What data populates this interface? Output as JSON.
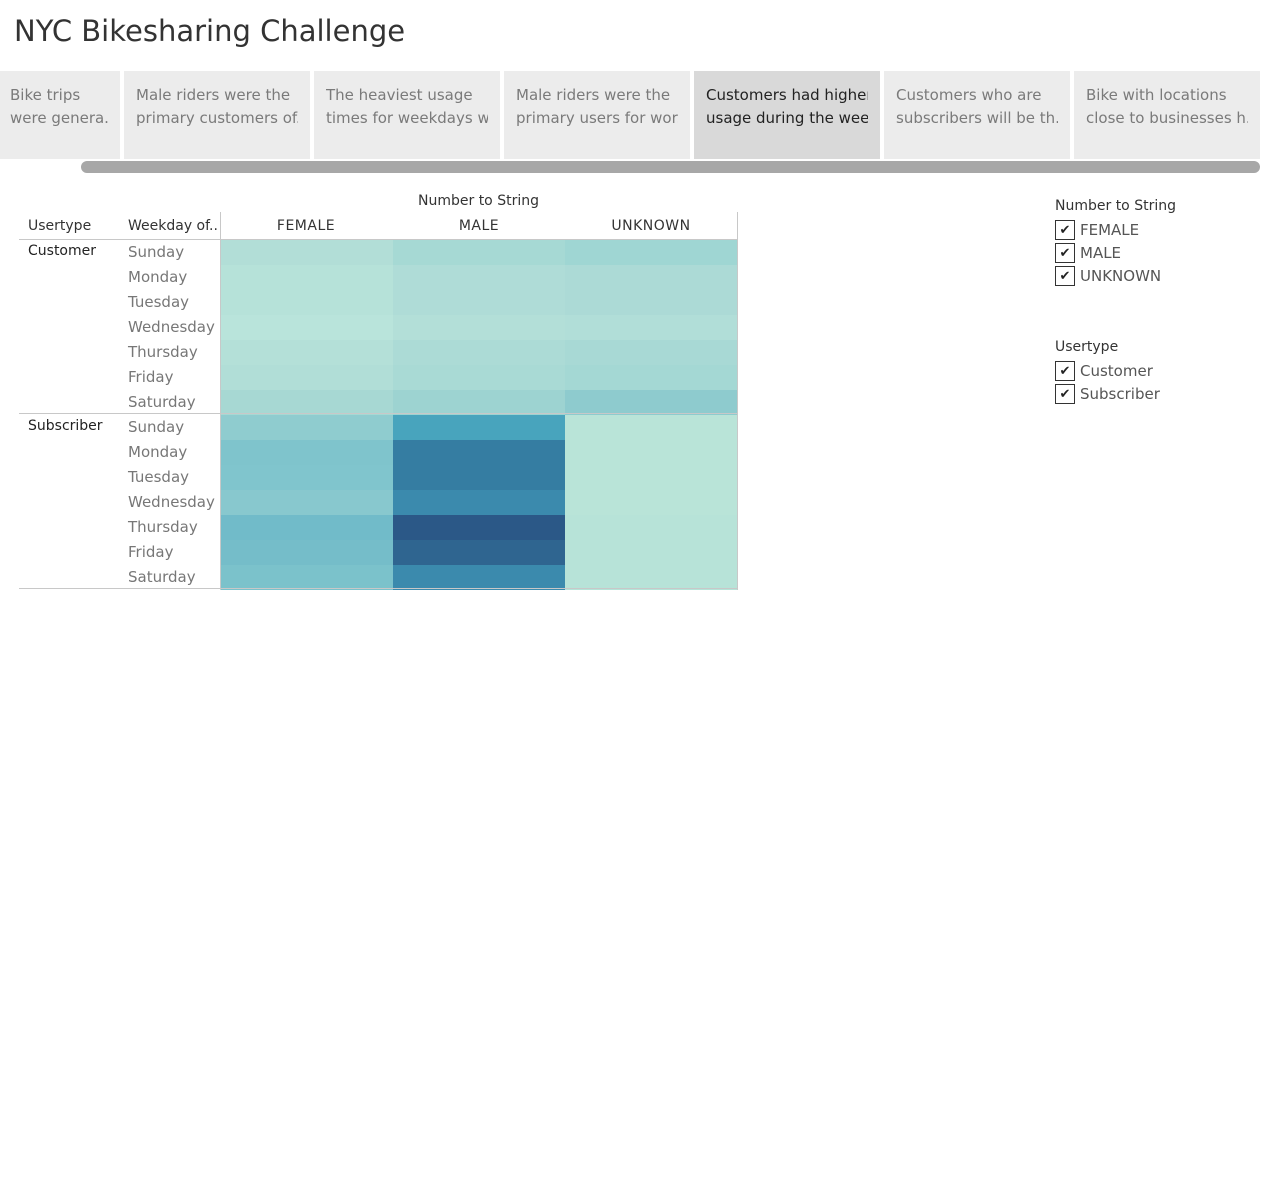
{
  "title": "NYC Bikesharing Challenge",
  "story_points": [
    {
      "line1": "Bike trips",
      "line2": "were genera..",
      "active": false
    },
    {
      "line1": "Male riders were the",
      "line2": "primary customers of..",
      "active": false
    },
    {
      "line1": "The heaviest usage",
      "line2": "times for weekdays w..",
      "active": false
    },
    {
      "line1": "Male riders were the",
      "line2": "primary users for wor..",
      "active": false
    },
    {
      "line1": "Customers had  higher",
      "line2": "usage during the wee..",
      "active": true
    },
    {
      "line1": "Customers who are",
      "line2": "subscribers will be th..",
      "active": false
    },
    {
      "line1": "Bike with locations",
      "line2": "close to businesses h..",
      "active": false
    }
  ],
  "heatmap": {
    "column_field_title": "Number to String",
    "row_header_usertype": "Usertype",
    "row_header_weekday": "Weekday of..",
    "columns": [
      "FEMALE",
      "MALE",
      "UNKNOWN"
    ],
    "groups": [
      {
        "label": "Customer",
        "days": [
          "Sunday",
          "Monday",
          "Tuesday",
          "Wednesday",
          "Thursday",
          "Friday",
          "Saturday"
        ]
      },
      {
        "label": "Subscriber",
        "days": [
          "Sunday",
          "Monday",
          "Tuesday",
          "Wednesday",
          "Thursday",
          "Friday",
          "Saturday"
        ]
      }
    ],
    "colors": [
      [
        "#b2ded7",
        "#a6d9d4",
        "#9fd6d3"
      ],
      [
        "#b6e2d9",
        "#afdcd7",
        "#acdad6"
      ],
      [
        "#b6e2d9",
        "#afdcd7",
        "#acdad6"
      ],
      [
        "#b9e4db",
        "#b3dfd8",
        "#b1ded8"
      ],
      [
        "#b4e0d8",
        "#acdbd6",
        "#a8d9d5"
      ],
      [
        "#b1ded7",
        "#a9dad5",
        "#a4d8d4"
      ],
      [
        "#a7d8d3",
        "#9dd3d1",
        "#8ecbce"
      ],
      [
        "#8fcccf",
        "#48a4bd",
        "#b9e4d8"
      ],
      [
        "#7fc4cc",
        "#357da2",
        "#b9e4d8"
      ],
      [
        "#80c5cd",
        "#357da2",
        "#b9e4d8"
      ],
      [
        "#88c8ce",
        "#3b8aad",
        "#b9e4d8"
      ],
      [
        "#71bbc9",
        "#2b5887",
        "#b7e3d8"
      ],
      [
        "#75bdc9",
        "#2f6590",
        "#b7e3d8"
      ],
      [
        "#7bc2cb",
        "#3b8aad",
        "#b7e3d8"
      ]
    ]
  },
  "filters": [
    {
      "title": "Number to String",
      "items": [
        "FEMALE",
        "MALE",
        "UNKNOWN"
      ]
    },
    {
      "title": "Usertype",
      "items": [
        "Customer",
        "Subscriber"
      ]
    }
  ]
}
